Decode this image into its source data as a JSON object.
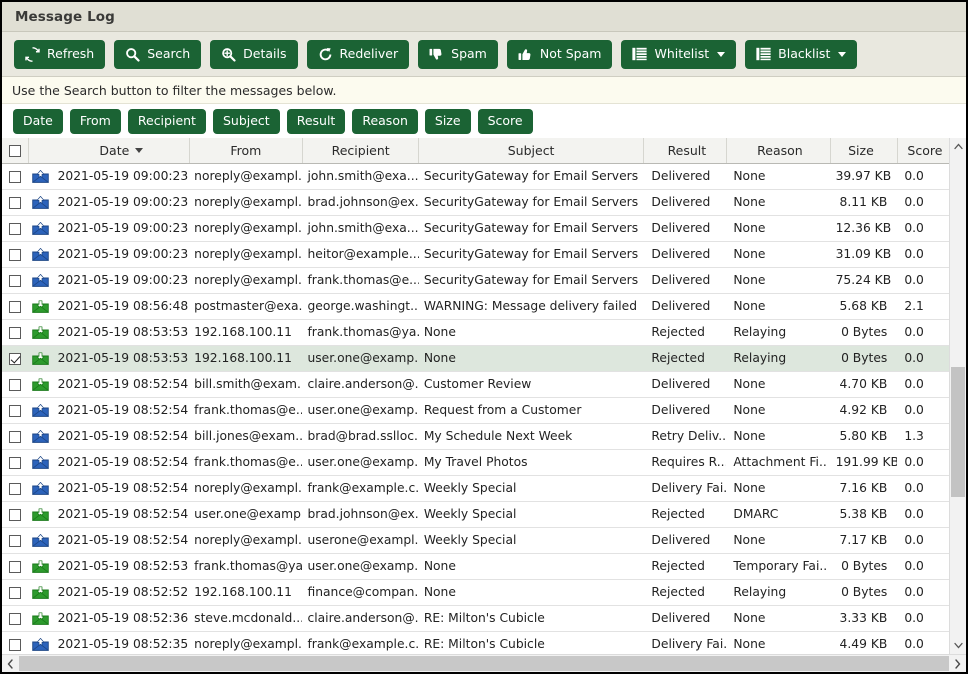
{
  "window": {
    "title": "Message Log"
  },
  "theme": {
    "accent_green": "#1b6334",
    "titlebar_bg": "#e0dfd4",
    "toolbar_bg": "#e9e8df",
    "infobar_bg": "#fcfbef",
    "selected_row_bg": "#dde7dd",
    "delivered_color": "#12922f",
    "rejected_color": "#e0352b",
    "inbound_icon_color": "#2a9a2a",
    "outbound_icon_color": "#2b63b8"
  },
  "toolbar": {
    "buttons": [
      {
        "label": "Refresh",
        "icon": "refresh-icon",
        "dropdown": false
      },
      {
        "label": "Search",
        "icon": "search-icon",
        "dropdown": false
      },
      {
        "label": "Details",
        "icon": "zoom-in-icon",
        "dropdown": false
      },
      {
        "label": "Redeliver",
        "icon": "redo-icon",
        "dropdown": false
      },
      {
        "label": "Spam",
        "icon": "thumbs-down-icon",
        "dropdown": false
      },
      {
        "label": "Not Spam",
        "icon": "thumbs-up-icon",
        "dropdown": false
      },
      {
        "label": "Whitelist",
        "icon": "list-icon",
        "dropdown": true
      },
      {
        "label": "Blacklist",
        "icon": "list-icon",
        "dropdown": true
      }
    ]
  },
  "info_bar": {
    "text": "Use the Search button to filter the messages below."
  },
  "filter_chips": [
    {
      "label": "Date"
    },
    {
      "label": "From"
    },
    {
      "label": "Recipient"
    },
    {
      "label": "Subject"
    },
    {
      "label": "Result"
    },
    {
      "label": "Reason"
    },
    {
      "label": "Size"
    },
    {
      "label": "Score"
    }
  ],
  "grid": {
    "select_all_checked": false,
    "sort_column": "Date",
    "sort_direction": "desc",
    "columns": [
      {
        "key": "checkbox",
        "label": ""
      },
      {
        "key": "icon",
        "label": ""
      },
      {
        "key": "date",
        "label": "Date"
      },
      {
        "key": "from",
        "label": "From"
      },
      {
        "key": "recipient",
        "label": "Recipient"
      },
      {
        "key": "subject",
        "label": "Subject"
      },
      {
        "key": "result",
        "label": "Result"
      },
      {
        "key": "reason",
        "label": "Reason"
      },
      {
        "key": "size",
        "label": "Size"
      },
      {
        "key": "score",
        "label": "Score"
      }
    ],
    "rows": [
      {
        "checked": false,
        "selected": false,
        "direction": "outbound",
        "date": "2021-05-19 09:00:23",
        "from": "noreply@exampl...",
        "recipient": "john.smith@exa...",
        "subject": "SecurityGateway for Email Servers ...",
        "result": "Delivered",
        "result_state": "delivered",
        "reason": "None",
        "size": "39.97 KB",
        "score": "0.0"
      },
      {
        "checked": false,
        "selected": false,
        "direction": "outbound",
        "date": "2021-05-19 09:00:23",
        "from": "noreply@exampl...",
        "recipient": "brad.johnson@ex.",
        "subject": "SecurityGateway for Email Servers ...",
        "result": "Delivered",
        "result_state": "delivered",
        "reason": "None",
        "size": "8.11 KB",
        "score": "0.0"
      },
      {
        "checked": false,
        "selected": false,
        "direction": "outbound",
        "date": "2021-05-19 09:00:23",
        "from": "noreply@exampl...",
        "recipient": "john.smith@exa...",
        "subject": "SecurityGateway for Email Servers ...",
        "result": "Delivered",
        "result_state": "delivered",
        "reason": "None",
        "size": "12.36 KB",
        "score": "0.0"
      },
      {
        "checked": false,
        "selected": false,
        "direction": "outbound",
        "date": "2021-05-19 09:00:23",
        "from": "noreply@exampl...",
        "recipient": "heitor@example...",
        "subject": "SecurityGateway for Email Servers ...",
        "result": "Delivered",
        "result_state": "delivered",
        "reason": "None",
        "size": "31.09 KB",
        "score": "0.0"
      },
      {
        "checked": false,
        "selected": false,
        "direction": "outbound",
        "date": "2021-05-19 09:00:23",
        "from": "noreply@exampl...",
        "recipient": "frank.thomas@e...",
        "subject": "SecurityGateway for Email Servers ...",
        "result": "Delivered",
        "result_state": "delivered",
        "reason": "None",
        "size": "75.24 KB",
        "score": "0.0"
      },
      {
        "checked": false,
        "selected": false,
        "direction": "inbound",
        "date": "2021-05-19 08:56:48",
        "from": "postmaster@exa...",
        "recipient": "george.washingt...",
        "subject": "WARNING: Message delivery failed",
        "result": "Delivered",
        "result_state": "delivered",
        "reason": "None",
        "size": "5.68 KB",
        "score": "2.1"
      },
      {
        "checked": false,
        "selected": false,
        "direction": "inbound",
        "date": "2021-05-19 08:53:53",
        "from": "192.168.100.11",
        "recipient": "frank.thomas@ya..",
        "subject": "None",
        "result": "Rejected",
        "result_state": "rejected",
        "reason": "Relaying",
        "size": "0 Bytes",
        "score": "0.0"
      },
      {
        "checked": true,
        "selected": true,
        "direction": "inbound",
        "date": "2021-05-19 08:53:53",
        "from": "192.168.100.11",
        "recipient": "user.one@examp..",
        "subject": "None",
        "result": "Rejected",
        "result_state": "rejected",
        "reason": "Relaying",
        "size": "0 Bytes",
        "score": "0.0"
      },
      {
        "checked": false,
        "selected": false,
        "direction": "inbound",
        "date": "2021-05-19 08:52:54",
        "from": "bill.smith@exam...",
        "recipient": "claire.anderson@..",
        "subject": "Customer Review",
        "result": "Delivered",
        "result_state": "delivered",
        "reason": "None",
        "size": "4.70 KB",
        "score": "0.0"
      },
      {
        "checked": false,
        "selected": false,
        "direction": "outbound",
        "date": "2021-05-19 08:52:54",
        "from": "frank.thomas@e...",
        "recipient": "user.one@examp..",
        "subject": "Request from a Customer",
        "result": "Delivered",
        "result_state": "delivered",
        "reason": "None",
        "size": "4.92 KB",
        "score": "0.0"
      },
      {
        "checked": false,
        "selected": false,
        "direction": "outbound",
        "date": "2021-05-19 08:52:54",
        "from": "bill.jones@exam...",
        "recipient": "brad@brad.sslloc..",
        "subject": "My Schedule Next Week",
        "result": "Retry Deliv...",
        "result_state": "retry",
        "reason": "None",
        "size": "5.80 KB",
        "score": "1.3"
      },
      {
        "checked": false,
        "selected": false,
        "direction": "outbound",
        "date": "2021-05-19 08:52:54",
        "from": "frank.thomas@e...",
        "recipient": "user.one@examp..",
        "subject": "My Travel Photos",
        "result": "Requires R...",
        "result_state": "requires",
        "reason": "Attachment Fi..",
        "size": "191.99 KB",
        "score": "0.0"
      },
      {
        "checked": false,
        "selected": false,
        "direction": "outbound",
        "date": "2021-05-19 08:52:54",
        "from": "noreply@exampl...",
        "recipient": "frank@example.c..",
        "subject": "Weekly Special",
        "result": "Delivery Fai..",
        "result_state": "failed",
        "reason": "None",
        "size": "7.16 KB",
        "score": "0.0"
      },
      {
        "checked": false,
        "selected": false,
        "direction": "inbound",
        "date": "2021-05-19 08:52:54",
        "from": "user.one@examp..",
        "recipient": "brad.johnson@ex.",
        "subject": "Weekly Special",
        "result": "Rejected",
        "result_state": "rejected",
        "reason": "DMARC",
        "size": "5.38 KB",
        "score": "0.0"
      },
      {
        "checked": false,
        "selected": false,
        "direction": "outbound",
        "date": "2021-05-19 08:52:54",
        "from": "noreply@exampl...",
        "recipient": "userone@exampl..",
        "subject": "Weekly Special",
        "result": "Delivered",
        "result_state": "delivered",
        "reason": "None",
        "size": "7.17 KB",
        "score": "0.0"
      },
      {
        "checked": false,
        "selected": false,
        "direction": "inbound",
        "date": "2021-05-19 08:52:53",
        "from": "frank.thomas@ya..",
        "recipient": "user.one@examp..",
        "subject": "None",
        "result": "Rejected",
        "result_state": "rejected",
        "reason": "Temporary Fai..",
        "size": "0 Bytes",
        "score": "0.0"
      },
      {
        "checked": false,
        "selected": false,
        "direction": "inbound",
        "date": "2021-05-19 08:52:52",
        "from": "192.168.100.11",
        "recipient": "finance@compan..",
        "subject": "None",
        "result": "Rejected",
        "result_state": "rejected",
        "reason": "Relaying",
        "size": "0 Bytes",
        "score": "0.0"
      },
      {
        "checked": false,
        "selected": false,
        "direction": "inbound",
        "date": "2021-05-19 08:52:36",
        "from": "steve.mcdonald...",
        "recipient": "claire.anderson@..",
        "subject": "RE: Milton's Cubicle",
        "result": "Delivered",
        "result_state": "delivered",
        "reason": "None",
        "size": "3.33 KB",
        "score": "0.0"
      },
      {
        "checked": false,
        "selected": false,
        "direction": "outbound",
        "date": "2021-05-19 08:52:35",
        "from": "noreply@exampl...",
        "recipient": "frank@example.c..",
        "subject": "RE: Milton's Cubicle",
        "result": "Delivery Fai..",
        "result_state": "failed",
        "reason": "None",
        "size": "4.49 KB",
        "score": "0.0"
      }
    ]
  },
  "scrollbars": {
    "vertical": {
      "up_icon": "chevron-up-icon",
      "down_icon": "chevron-down-icon"
    },
    "horizontal": {
      "left_icon": "chevron-left-icon",
      "right_icon": "chevron-right-icon"
    }
  }
}
